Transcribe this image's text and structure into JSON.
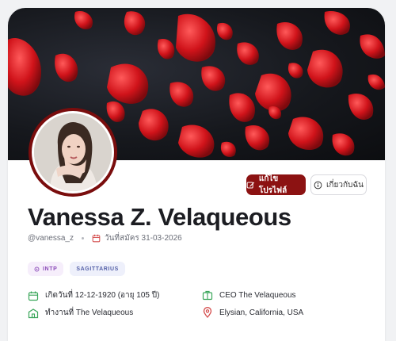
{
  "profile": {
    "name": "Vanessa Z. Velaqueous",
    "username": "@vanessa_z",
    "joined": "วันที่สมัคร 31-03-2026",
    "tags": [
      "INTP",
      "SAGITTARIUS"
    ],
    "birth": "เกิดวันที่ 12-12-1920 (อายุ 105 ปี)",
    "position": "CEO The Velaqueous",
    "workplace": "ทำงานที่ The Velaqueous",
    "location": "Elysian, California, USA"
  },
  "actions": {
    "edit_label": "แก้ไขโปรไฟล์",
    "about_label": "เกี่ยวกับฉัน"
  },
  "colors": {
    "accent": "#8c1212",
    "avatar_ring": "#7a0d0d",
    "petal": "#d0131a",
    "icon_green": "#3aa65a",
    "icon_red": "#d44b4b"
  },
  "icons": {
    "edit": "edit-icon",
    "about": "info-icon",
    "calendar": "calendar-icon",
    "intp": "flower-icon",
    "birthday": "cake-icon",
    "briefcase": "briefcase-icon",
    "building": "building-icon",
    "location": "map-pin-icon"
  }
}
